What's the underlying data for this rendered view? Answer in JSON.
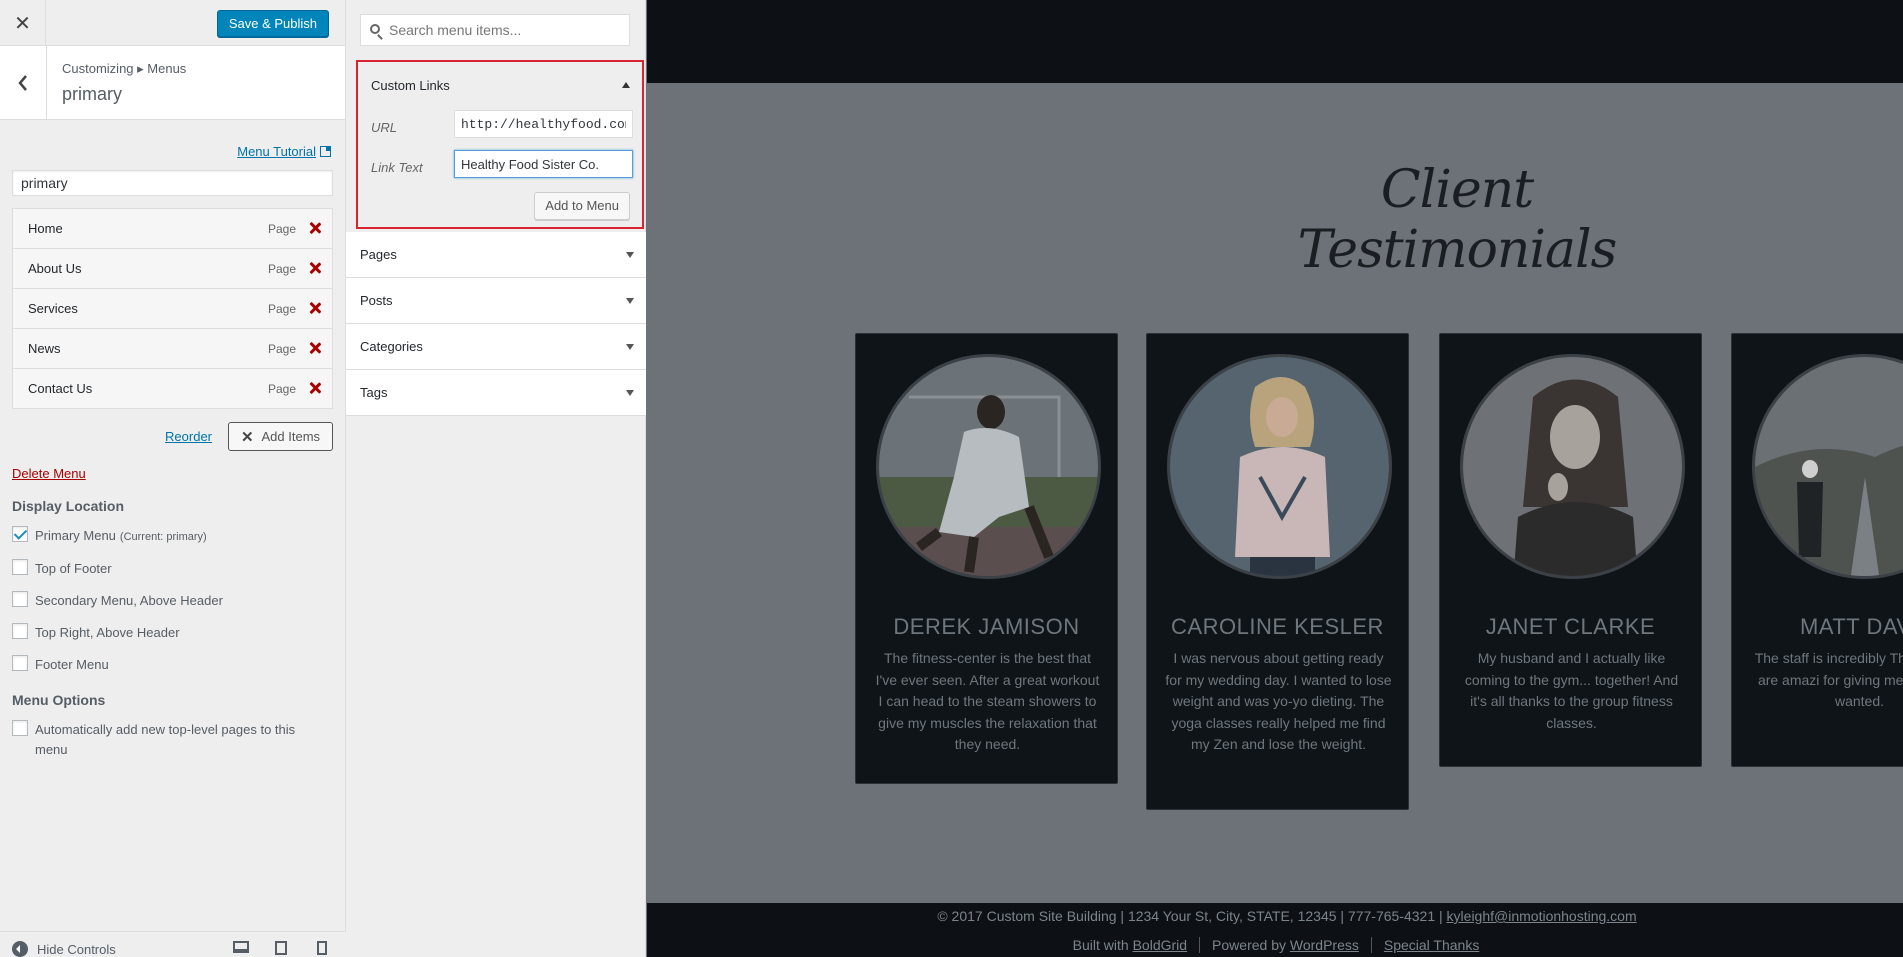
{
  "customizer": {
    "publish_label": "Save & Publish",
    "breadcrumb": "Customizing ▸ Menus",
    "section_title": "primary",
    "menu_tutorial_label": "Menu Tutorial",
    "menu_name_value": "primary",
    "menu_items": [
      {
        "label": "Home",
        "type": "Page"
      },
      {
        "label": "About Us",
        "type": "Page"
      },
      {
        "label": "Services",
        "type": "Page"
      },
      {
        "label": "News",
        "type": "Page"
      },
      {
        "label": "Contact Us",
        "type": "Page"
      }
    ],
    "reorder_label": "Reorder",
    "add_items_label": "Add Items",
    "delete_menu_label": "Delete Menu",
    "display_location_title": "Display Location",
    "locations": [
      {
        "label": "Primary Menu",
        "note": "(Current: primary)",
        "checked": true
      },
      {
        "label": "Top of Footer",
        "note": "",
        "checked": false
      },
      {
        "label": "Secondary Menu, Above Header",
        "note": "",
        "checked": false
      },
      {
        "label": "Top Right, Above Header",
        "note": "",
        "checked": false
      },
      {
        "label": "Footer Menu",
        "note": "",
        "checked": false
      }
    ],
    "menu_options_title": "Menu Options",
    "auto_add_label": "Automatically add new top-level pages to this menu",
    "hide_controls_label": "Hide Controls"
  },
  "add_panel": {
    "search_placeholder": "Search menu items...",
    "custom_links": {
      "title": "Custom Links",
      "url_label": "URL",
      "url_value": "http://healthyfood.com",
      "link_text_label": "Link Text",
      "link_text_value": "Healthy Food Sister Co.",
      "add_button_label": "Add to Menu"
    },
    "sections": [
      "Pages",
      "Posts",
      "Categories",
      "Tags"
    ]
  },
  "preview": {
    "title": "Client Testimonials",
    "testimonials": [
      {
        "name": "DEREK JAMISON",
        "quote": "The fitness-center is the best that I've ever seen. After a great workout I can head to the steam showers to give my muscles the relaxation that they need."
      },
      {
        "name": "CAROLINE KESLER",
        "quote": "I was nervous about getting ready for my wedding day. I wanted to lose weight and was yo-yo dieting. The yoga classes really helped me find my Zen and lose the weight."
      },
      {
        "name": "JANET CLARKE",
        "quote": "My husband and I actually like coming to the gym... together! And it's all thanks to the group fitness classes."
      },
      {
        "name": "MATT DAV",
        "quote": "The staff is incredibly The trainers are amazi for giving me the body wanted."
      }
    ],
    "footer": {
      "copyright": "© 2017 Custom Site Building | 1234 Your St, City, STATE, 12345 | 777-765-4321 |",
      "email": "kyleighf@inmotionhosting.com",
      "built_with": "Built with",
      "boldgrid": "BoldGrid",
      "powered_by": "Powered by",
      "wordpress": "WordPress",
      "special_thanks": "Special Thanks"
    }
  }
}
